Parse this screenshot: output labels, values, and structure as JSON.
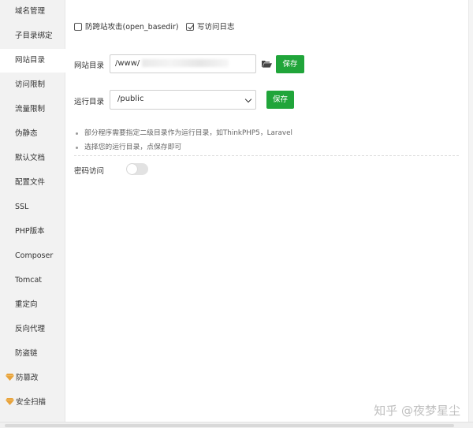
{
  "sidebar": {
    "items": [
      {
        "label": "域名管理"
      },
      {
        "label": "子目录绑定"
      },
      {
        "label": "网站目录",
        "active": true
      },
      {
        "label": "访问限制"
      },
      {
        "label": "流量限制"
      },
      {
        "label": "伪静态"
      },
      {
        "label": "默认文档"
      },
      {
        "label": "配置文件"
      },
      {
        "label": "SSL"
      },
      {
        "label": "PHP版本"
      },
      {
        "label": "Composer"
      },
      {
        "label": "Tomcat"
      },
      {
        "label": "重定向"
      },
      {
        "label": "反向代理"
      },
      {
        "label": "防盗链"
      },
      {
        "label": "防篡改",
        "icon": "gem-icon"
      },
      {
        "label": "安全扫描",
        "icon": "gem-icon"
      }
    ]
  },
  "options": {
    "anti_cross_site_label": "防跨站攻击(open_basedir)",
    "anti_cross_site_checked": false,
    "access_log_label": "写访问日志",
    "access_log_checked": true
  },
  "site_dir": {
    "label": "网站目录",
    "value": "/www/",
    "save_label": "保存"
  },
  "run_dir": {
    "label": "运行目录",
    "selected": "/public",
    "save_label": "保存"
  },
  "tips": [
    "部分程序需要指定二级目录作为运行目录，如ThinkPHP5，Laravel",
    "选择您的运行目录，点保存即可"
  ],
  "password_access": {
    "label": "密码访问",
    "enabled": false
  },
  "watermark": "知乎 @夜梦星尘",
  "colors": {
    "accent": "#20a53a",
    "sidebar_bg": "#f2f2f2",
    "gem": "#e8a33c"
  }
}
